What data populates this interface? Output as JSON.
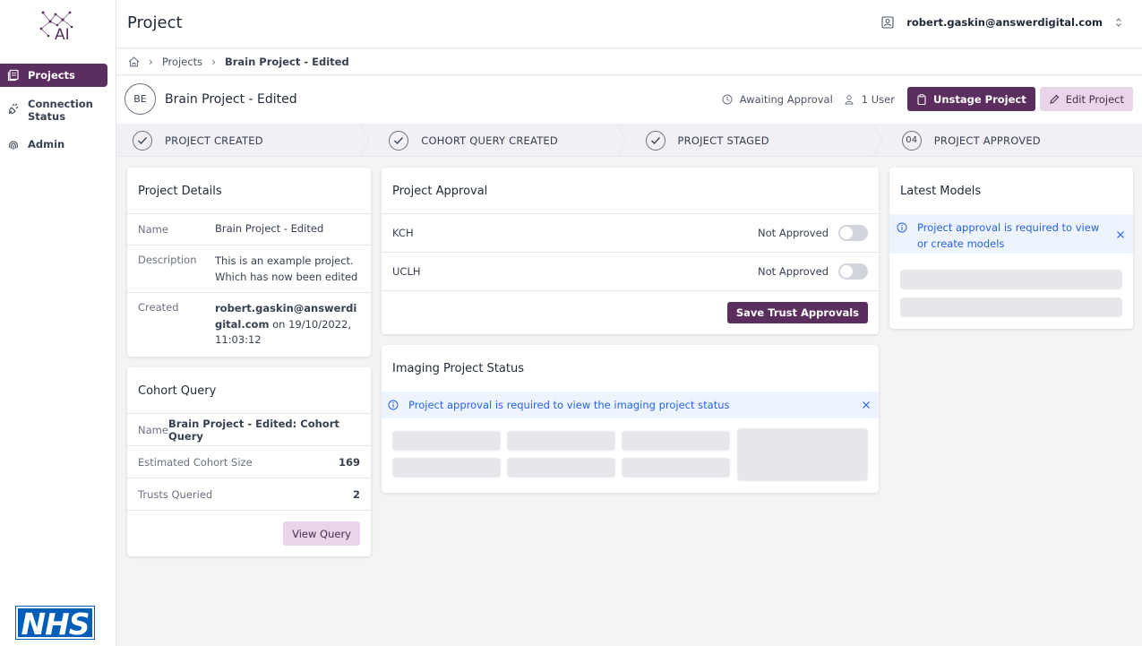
{
  "brand": {
    "logo_text": "AI",
    "nhs_text": "NHS"
  },
  "sidebar": {
    "items": [
      {
        "label": "Projects",
        "icon": "projects-icon"
      },
      {
        "label": "Connection Status",
        "icon": "plug-icon"
      },
      {
        "label": "Admin",
        "icon": "fingerprint-icon"
      }
    ]
  },
  "header": {
    "title": "Project",
    "user_email": "robert.gaskin@answerdigital.com"
  },
  "breadcrumb": {
    "items": [
      "Projects",
      "Brain Project - Edited"
    ]
  },
  "project": {
    "initials": "BE",
    "name": "Brain Project - Edited",
    "status": "Awaiting Approval",
    "users": "1 User",
    "unstage_label": "Unstage Project",
    "edit_label": "Edit Project"
  },
  "steps": [
    {
      "label": "PROJECT CREATED",
      "state": "done"
    },
    {
      "label": "COHORT QUERY CREATED",
      "state": "done"
    },
    {
      "label": "PROJECT STAGED",
      "state": "done"
    },
    {
      "label": "PROJECT APPROVED",
      "state": "pending",
      "number": "04"
    }
  ],
  "project_details": {
    "title": "Project Details",
    "name_label": "Name",
    "name_value": "Brain Project - Edited",
    "desc_label": "Description",
    "desc_value": "This is an example project. Which has now been edited",
    "created_label": "Created",
    "created_by": "robert.gaskin@answerdigital.com",
    "created_on": " on 19/10/2022, 11:03:12"
  },
  "cohort_query": {
    "title": "Cohort Query",
    "name_label": "Name",
    "name_value": "Brain Project - Edited: Cohort Query",
    "size_label": "Estimated Cohort Size",
    "size_value": "169",
    "trusts_label": "Trusts Queried",
    "trusts_value": "2",
    "view_label": "View Query"
  },
  "project_approval": {
    "title": "Project Approval",
    "trusts": [
      {
        "name": "KCH",
        "status": "Not Approved"
      },
      {
        "name": "UCLH",
        "status": "Not Approved"
      }
    ],
    "save_label": "Save Trust Approvals"
  },
  "imaging_status": {
    "title": "Imaging Project Status",
    "message": "Project approval is required to view the imaging project status"
  },
  "latest_models": {
    "title": "Latest Models",
    "message": "Project approval is required to view or create models"
  },
  "colors": {
    "primary": "#5c2e5f",
    "primary_light": "#e8d5ea",
    "info_bg": "#eef4fd",
    "info_text": "#2563eb",
    "nhs_blue": "#005eb8"
  }
}
